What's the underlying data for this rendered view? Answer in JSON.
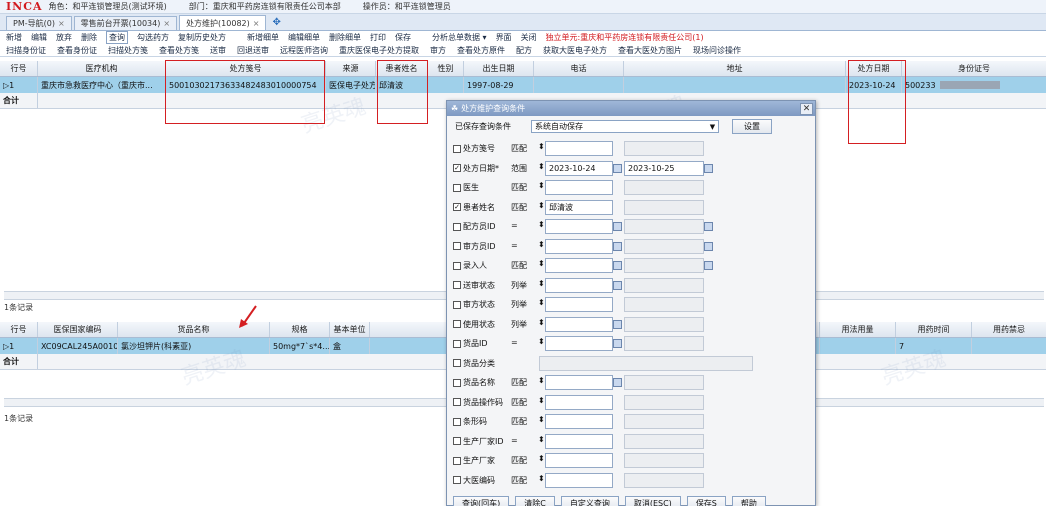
{
  "topbar": {
    "logo": "INCA",
    "role": "角色：和平连锁管理员(测试环境)",
    "dept": "部门：重庆和平药房连锁有限责任公司本部",
    "operator": "操作员：和平连锁管理员"
  },
  "tabs": [
    {
      "label": "PM-导航(0)"
    },
    {
      "label": "零售前台开票(10034)"
    },
    {
      "label": "处方维护(10082)"
    }
  ],
  "menu1": {
    "items": [
      "新增",
      "编辑",
      "放弃",
      "删除",
      "查询",
      "勾选药方",
      "复制历史处方",
      "新增细单",
      "编辑细单",
      "删除细单",
      "打印",
      "保存",
      "分析总单数据 ▾",
      "界面",
      "关闭"
    ],
    "unit_label": "独立单元:重庆和平药房连锁有限责任公司(1)"
  },
  "menu2": {
    "items": [
      "扫描身份证",
      "查看身份证",
      "扫描处方笺",
      "查看处方笺",
      "送审",
      "回退送审",
      "远程医师咨询",
      "重庆医保电子处方提取",
      "审方",
      "查看处方原件",
      "配方",
      "获取大医电子处方",
      "查看大医处方图片",
      "现场问诊操作"
    ]
  },
  "top_grid": {
    "columns": [
      "行号",
      "医疗机构",
      "处方笺号",
      "来源",
      "患者姓名",
      "性别",
      "出生日期",
      "电话",
      "地址",
      "处方日期",
      "身份证号"
    ],
    "row": {
      "line": "1",
      "org": "重庆市急救医疗中心（重庆市...",
      "rx_no": "50010302173633482483010000754",
      "source": "医保电子处方",
      "patient": "邱清波",
      "gender": "",
      "birth": "1997-08-29",
      "phone": "",
      "address": "",
      "rx_date": "2023-10-24",
      "id_no": "500233"
    },
    "sum_label": "合计",
    "records": "1条记录"
  },
  "bottom_grid": {
    "columns": [
      "行号",
      "医保国家编码",
      "货品名称",
      "规格",
      "基本单位",
      "产地",
      "用法用量",
      "用药时间",
      "用药禁忌"
    ],
    "row": {
      "line": "1",
      "code": "XC09CAL245A0010...",
      "name": "氯沙坦钾片(科素亚)",
      "spec": "50mg*7`s*4...",
      "unit": "盒",
      "origin": "",
      "usage": "",
      "time": "7",
      "taboo": ""
    },
    "sum_label": "合计",
    "records": "1条记录"
  },
  "dialog": {
    "title": "处方维护查询条件",
    "saved_label": "已保存查询条件",
    "saved_value": "系统自动保存",
    "settings_btn": "设置",
    "conditions": [
      {
        "label": "处方笺号",
        "checked": false,
        "op": "匹配",
        "v1": "",
        "v2": ""
      },
      {
        "label": "处方日期*",
        "checked": true,
        "op": "范围",
        "v1": "2023-10-24",
        "v2": "2023-10-25"
      },
      {
        "label": "医生",
        "checked": false,
        "op": "匹配",
        "v1": "",
        "v2": ""
      },
      {
        "label": "患者姓名",
        "checked": true,
        "op": "匹配",
        "v1": "邱清波",
        "v2": ""
      },
      {
        "label": "配方员ID",
        "checked": false,
        "op": "=",
        "v1": "",
        "v2": ""
      },
      {
        "label": "审方员ID",
        "checked": false,
        "op": "=",
        "v1": "",
        "v2": ""
      },
      {
        "label": "录入人",
        "checked": false,
        "op": "匹配",
        "v1": "",
        "v2": ""
      },
      {
        "label": "送审状态",
        "checked": false,
        "op": "列举",
        "v1": "",
        "v2": ""
      },
      {
        "label": "审方状态",
        "checked": false,
        "op": "列举",
        "v1": "",
        "v2": ""
      },
      {
        "label": "使用状态",
        "checked": false,
        "op": "列举",
        "v1": "",
        "v2": ""
      },
      {
        "label": "货品ID",
        "checked": false,
        "op": "=",
        "v1": "",
        "v2": ""
      },
      {
        "label": "货品分类",
        "checked": false,
        "op": "",
        "v1": "",
        "v2": ""
      },
      {
        "label": "货品名称",
        "checked": false,
        "op": "匹配",
        "v1": "",
        "v2": ""
      },
      {
        "label": "货品操作码",
        "checked": false,
        "op": "匹配",
        "v1": "",
        "v2": ""
      },
      {
        "label": "条形码",
        "checked": false,
        "op": "匹配",
        "v1": "",
        "v2": ""
      },
      {
        "label": "生产厂家ID",
        "checked": false,
        "op": "=",
        "v1": "",
        "v2": ""
      },
      {
        "label": "生产厂家",
        "checked": false,
        "op": "匹配",
        "v1": "",
        "v2": ""
      },
      {
        "label": "大医编码",
        "checked": false,
        "op": "匹配",
        "v1": "",
        "v2": ""
      }
    ],
    "buttons": [
      "查询(回车)",
      "清除C",
      "自定义查询",
      "取消(ESC)",
      "保存S",
      "帮助"
    ]
  },
  "watermark": "亮英魂"
}
